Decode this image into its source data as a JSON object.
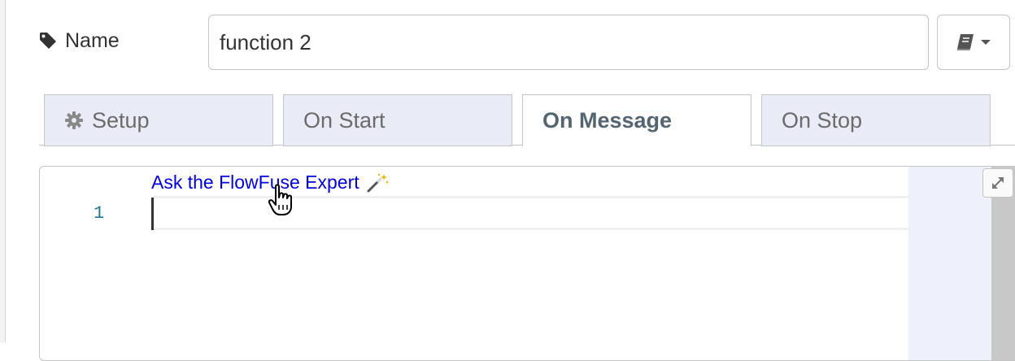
{
  "name_field": {
    "label": "Name",
    "value": "function 2",
    "icon": "tag-icon"
  },
  "library_button": {
    "icon": "book-icon",
    "caret": "caret-down-icon"
  },
  "tabs": [
    {
      "label": "Setup",
      "icon": "gear-icon",
      "active": false
    },
    {
      "label": "On Start",
      "active": false
    },
    {
      "label": "On Message",
      "active": true
    },
    {
      "label": "On Stop",
      "active": false
    }
  ],
  "editor": {
    "ask_link": "Ask the FlowFuse Expert",
    "ask_icon": "magic-wand-icon",
    "line_numbers": [
      "1"
    ],
    "expand_icon": "expand-icon"
  },
  "colors": {
    "tab_inactive_bg": "#e9ecf7",
    "link": "#0000dd",
    "line_number": "#237893",
    "minimap_bg": "#eef0fb"
  }
}
